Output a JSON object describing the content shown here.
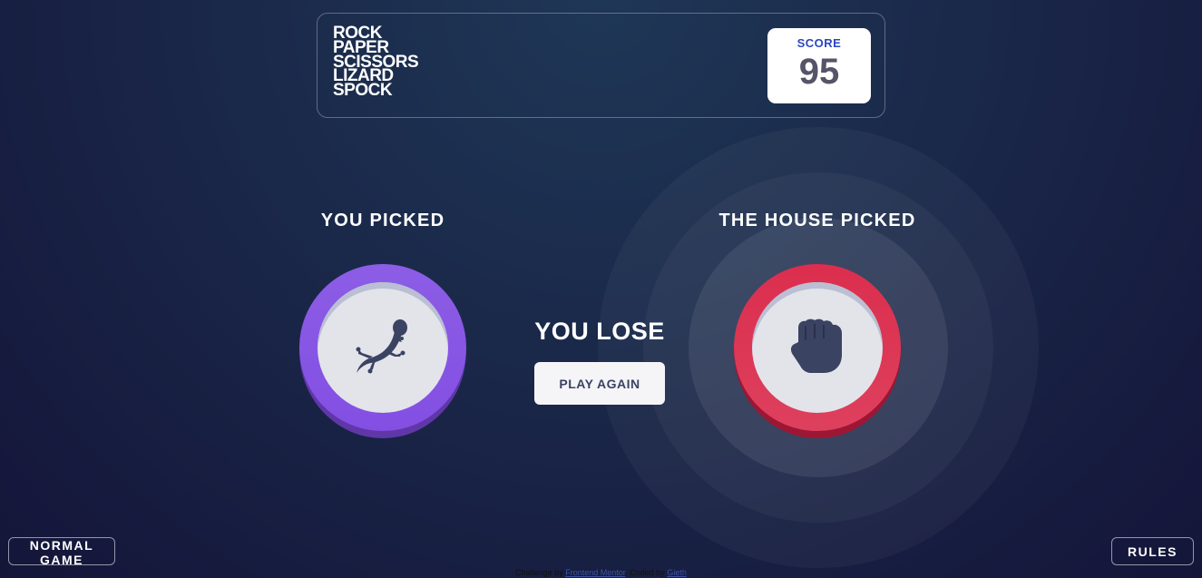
{
  "header": {
    "title_lines": [
      "ROCK",
      "PAPER",
      "SCISSORS",
      "LIZARD",
      "SPOCK"
    ],
    "score_label": "SCORE",
    "score_value": "95"
  },
  "game": {
    "you_label": "YOU PICKED",
    "house_label": "THE HOUSE PICKED",
    "you_pick": "lizard",
    "house_pick": "rock",
    "result": "YOU LOSE",
    "play_again": "PLAY AGAIN"
  },
  "footer": {
    "mode_button": "NORMAL GAME",
    "rules_button": "RULES",
    "attribution_prefix": "Challenge by",
    "attribution_link1": "Frontend Mentor",
    "attribution_mid": ". Coded by",
    "attribution_link2": "Gieth"
  },
  "colors": {
    "lizard": "#8c5de5",
    "rock": "#dc2e4e",
    "score_label": "#2a46c0",
    "background": "#141539"
  },
  "icons": {
    "you_pick": "lizard-icon",
    "house_pick": "rock-fist-icon"
  }
}
